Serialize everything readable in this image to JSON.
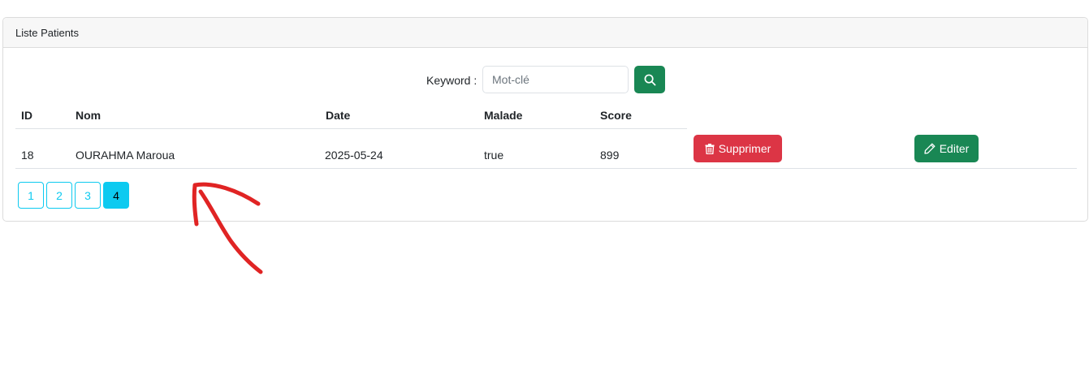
{
  "card": {
    "title": "Liste Patients"
  },
  "search": {
    "label": "Keyword :",
    "placeholder": "Mot-clé",
    "value": ""
  },
  "table": {
    "headers": [
      "ID",
      "Nom",
      "Date",
      "Malade",
      "Score"
    ],
    "rows": [
      {
        "id": "18",
        "nom": "OURAHMA Maroua",
        "date": "2025-05-24",
        "malade": "true",
        "score": "899",
        "delete_label": "Supprimer",
        "edit_label": "Editer"
      }
    ]
  },
  "pagination": {
    "pages": [
      "1",
      "2",
      "3",
      "4"
    ],
    "current": "4"
  },
  "colors": {
    "success": "#198754",
    "danger": "#dc3545",
    "info": "#0dcaf0",
    "annotation": "#e02424"
  }
}
